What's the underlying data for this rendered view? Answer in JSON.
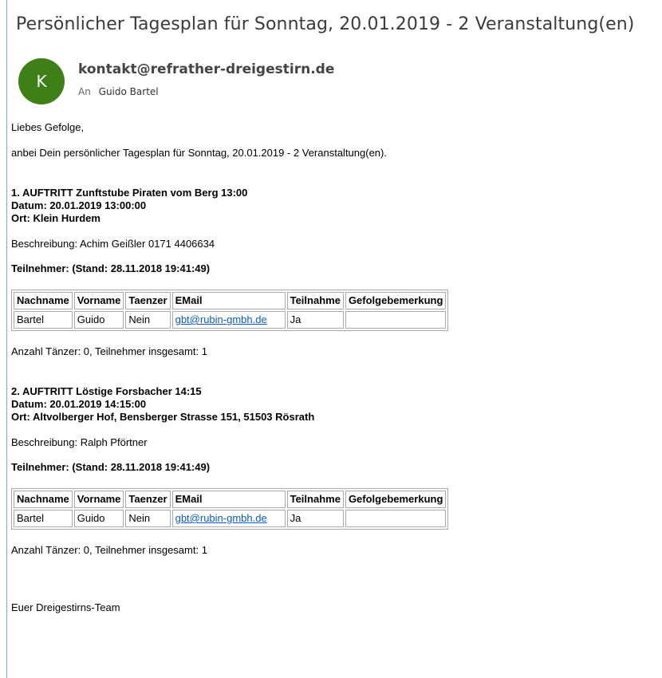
{
  "email": {
    "subject": "Persönlicher Tagesplan für Sonntag, 20.01.2019 - 2 Veranstaltung(en)",
    "avatar_letter": "K",
    "sender": "kontakt@refrather-dreigestirn.de",
    "to_prefix": "An",
    "to_name": "Guido Bartel",
    "accent_color": "#3f7f17"
  },
  "body": {
    "greeting": "Liebes Gefolge,",
    "intro": "anbei Dein persönlicher Tagesplan für Sonntag, 20.01.2019 - 2 Veranstaltung(en).",
    "events": [
      {
        "title": "1. AUFTRITT Zunftstube Piraten vom Berg 13:00",
        "date": "Datum: 20.01.2019 13:00:00",
        "place": "Ort: Klein Hurdem",
        "description": "Beschreibung: Achim Geißler 0171 4406634",
        "participants_heading": "Teilnehmer: (Stand: 28.11.2018 19:41:49)",
        "columns": [
          "Nachname",
          "Vorname",
          "Taenzer",
          "EMail",
          "Teilnahme",
          "Gefolgebemerkung"
        ],
        "rows": [
          {
            "nachname": "Bartel",
            "vorname": "Guido",
            "taenzer": "Nein",
            "email": "gbt@rubin-gmbh.de",
            "teilnahme": "Ja",
            "bemerkung": ""
          }
        ],
        "summary": "Anzahl Tänzer: 0, Teilnehmer insgesamt: 1"
      },
      {
        "title": "2. AUFTRITT Löstige Forsbacher 14:15",
        "date": "Datum: 20.01.2019 14:15:00",
        "place": "Ort: Altvolberger Hof, Bensberger Strasse 151, 51503 Rösrath",
        "description": "Beschreibung: Ralph Pförtner",
        "participants_heading": "Teilnehmer: (Stand: 28.11.2018 19:41:49)",
        "columns": [
          "Nachname",
          "Vorname",
          "Taenzer",
          "EMail",
          "Teilnahme",
          "Gefolgebemerkung"
        ],
        "rows": [
          {
            "nachname": "Bartel",
            "vorname": "Guido",
            "taenzer": "Nein",
            "email": "gbt@rubin-gmbh.de",
            "teilnahme": "Ja",
            "bemerkung": ""
          }
        ],
        "summary": "Anzahl Tänzer: 0, Teilnehmer insgesamt: 1"
      }
    ],
    "signature": "Euer Dreigestirns-Team"
  }
}
